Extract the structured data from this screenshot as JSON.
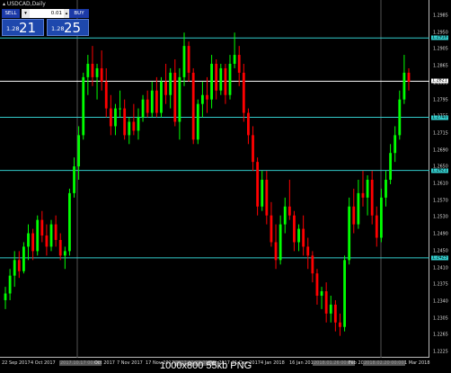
{
  "window": {
    "title": "USDCAD,Daily"
  },
  "trade_panel": {
    "sell_label": "SELL",
    "buy_label": "BUY",
    "lot_minus": "▾",
    "lot_value": "0.01",
    "lot_plus": "▴",
    "sell_price_small": "1.28",
    "sell_price_big": "21",
    "buy_price_small": "1.28",
    "buy_price_big": "25"
  },
  "price_axis": {
    "labels": [
      "1.2985",
      "1.2950",
      "1.2905",
      "1.2865",
      "1.2835",
      "1.2795",
      "1.2755",
      "1.2715",
      "1.2690",
      "1.2650",
      "1.2610",
      "1.2570",
      "1.2530",
      "1.2490",
      "1.2450",
      "1.2410",
      "1.2375",
      "1.2340",
      "1.2305",
      "1.2265",
      "1.2225"
    ],
    "tags": [
      {
        "text": "1.2918",
        "color": "cyan",
        "price": 1.2918
      },
      {
        "text": "1.2821",
        "color": "white",
        "price": 1.2821
      },
      {
        "text": "1.2740",
        "color": "cyan",
        "price": 1.274
      },
      {
        "text": "1.2621",
        "color": "cyan",
        "price": 1.2621
      },
      {
        "text": "1.2425",
        "color": "cyan",
        "price": 1.2425
      }
    ]
  },
  "time_axis": {
    "labels": [
      {
        "text": "22 Sep 2017",
        "sel": false
      },
      {
        "text": "4 Oct 2017",
        "sel": false
      },
      {
        "text": "2017.10.17 00:00",
        "sel": true
      },
      {
        "text": "Oct 2017",
        "sel": false
      },
      {
        "text": "7 Nov 2017",
        "sel": false
      },
      {
        "text": "17 Nov 2017",
        "sel": false
      },
      {
        "text": "2017.11.29 00:00",
        "sel": true
      },
      {
        "text": "Dec 2017",
        "sel": false
      },
      {
        "text": "21 Dec 2017",
        "sel": false
      },
      {
        "text": "4 Jan 2018",
        "sel": false
      },
      {
        "text": "16 Jan 2018",
        "sel": false
      },
      {
        "text": "2018.01.26 00:00",
        "sel": true
      },
      {
        "text": "Feb 2018",
        "sel": false
      },
      {
        "text": "2018.02.20 00:00",
        "sel": true
      },
      {
        "text": "1 Mar 2018",
        "sel": false
      }
    ]
  },
  "watermark": "1000x800 55kb PNG",
  "colors": {
    "bull": "#00ff00",
    "bear": "#ff0000",
    "hline_cyan": "#33cccc",
    "hline_white": "#ffffff"
  },
  "chart_data": {
    "type": "candlestick",
    "symbol": "USDCAD",
    "timeframe": "Daily",
    "ylim": [
      1.2205,
      1.2995
    ],
    "horizontal_levels": [
      1.2918,
      1.2821,
      1.274,
      1.2621,
      1.2425
    ],
    "candles": [
      [
        1.233,
        1.236,
        1.231,
        1.2345
      ],
      [
        1.2345,
        1.24,
        1.233,
        1.2385
      ],
      [
        1.2385,
        1.244,
        1.236,
        1.242
      ],
      [
        1.242,
        1.244,
        1.238,
        1.2395
      ],
      [
        1.2395,
        1.246,
        1.239,
        1.245
      ],
      [
        1.245,
        1.25,
        1.242,
        1.248
      ],
      [
        1.248,
        1.249,
        1.242,
        1.244
      ],
      [
        1.244,
        1.252,
        1.243,
        1.251
      ],
      [
        1.251,
        1.253,
        1.246,
        1.2475
      ],
      [
        1.2475,
        1.25,
        1.243,
        1.245
      ],
      [
        1.245,
        1.251,
        1.244,
        1.25
      ],
      [
        1.25,
        1.252,
        1.245,
        1.2465
      ],
      [
        1.2465,
        1.248,
        1.242,
        1.243
      ],
      [
        1.243,
        1.245,
        1.24,
        1.244
      ],
      [
        1.244,
        1.258,
        1.243,
        1.257
      ],
      [
        1.257,
        1.265,
        1.256,
        1.263
      ],
      [
        1.263,
        1.272,
        1.26,
        1.27
      ],
      [
        1.27,
        1.284,
        1.269,
        1.283
      ],
      [
        1.283,
        1.288,
        1.279,
        1.286
      ],
      [
        1.286,
        1.29,
        1.281,
        1.283
      ],
      [
        1.283,
        1.286,
        1.278,
        1.285
      ],
      [
        1.285,
        1.289,
        1.28,
        1.282
      ],
      [
        1.282,
        1.285,
        1.274,
        1.276
      ],
      [
        1.276,
        1.279,
        1.27,
        1.272
      ],
      [
        1.272,
        1.277,
        1.27,
        1.276
      ],
      [
        1.276,
        1.28,
        1.274,
        1.276
      ],
      [
        1.276,
        1.278,
        1.269,
        1.27
      ],
      [
        1.27,
        1.274,
        1.268,
        1.273
      ],
      [
        1.273,
        1.277,
        1.27,
        1.271
      ],
      [
        1.271,
        1.276,
        1.269,
        1.274
      ],
      [
        1.274,
        1.279,
        1.273,
        1.278
      ],
      [
        1.278,
        1.28,
        1.274,
        1.275
      ],
      [
        1.275,
        1.282,
        1.274,
        1.28
      ],
      [
        1.28,
        1.283,
        1.274,
        1.275
      ],
      [
        1.275,
        1.283,
        1.274,
        1.282
      ],
      [
        1.282,
        1.286,
        1.277,
        1.279
      ],
      [
        1.279,
        1.285,
        1.276,
        1.284
      ],
      [
        1.284,
        1.287,
        1.272,
        1.273
      ],
      [
        1.273,
        1.285,
        1.269,
        1.283
      ],
      [
        1.283,
        1.293,
        1.281,
        1.29
      ],
      [
        1.29,
        1.291,
        1.282,
        1.284
      ],
      [
        1.284,
        1.285,
        1.268,
        1.269
      ],
      [
        1.269,
        1.278,
        1.268,
        1.277
      ],
      [
        1.277,
        1.282,
        1.274,
        1.279
      ],
      [
        1.279,
        1.283,
        1.275,
        1.278
      ],
      [
        1.278,
        1.288,
        1.276,
        1.286
      ],
      [
        1.286,
        1.287,
        1.278,
        1.28
      ],
      [
        1.28,
        1.286,
        1.279,
        1.285
      ],
      [
        1.285,
        1.286,
        1.277,
        1.279
      ],
      [
        1.279,
        1.288,
        1.278,
        1.286
      ],
      [
        1.286,
        1.293,
        1.285,
        1.288
      ],
      [
        1.288,
        1.29,
        1.281,
        1.284
      ],
      [
        1.284,
        1.286,
        1.273,
        1.275
      ],
      [
        1.275,
        1.276,
        1.268,
        1.27
      ],
      [
        1.27,
        1.272,
        1.262,
        1.264
      ],
      [
        1.264,
        1.265,
        1.252,
        1.254
      ],
      [
        1.254,
        1.262,
        1.253,
        1.26
      ],
      [
        1.26,
        1.262,
        1.25,
        1.252
      ],
      [
        1.252,
        1.255,
        1.245,
        1.246
      ],
      [
        1.246,
        1.25,
        1.24,
        1.242
      ],
      [
        1.242,
        1.252,
        1.241,
        1.25
      ],
      [
        1.25,
        1.256,
        1.248,
        1.254
      ],
      [
        1.254,
        1.26,
        1.251,
        1.252
      ],
      [
        1.252,
        1.253,
        1.244,
        1.246
      ],
      [
        1.246,
        1.25,
        1.244,
        1.249
      ],
      [
        1.249,
        1.252,
        1.243,
        1.245
      ],
      [
        1.245,
        1.247,
        1.24,
        1.243
      ],
      [
        1.243,
        1.244,
        1.237,
        1.239
      ],
      [
        1.239,
        1.24,
        1.232,
        1.234
      ],
      [
        1.234,
        1.236,
        1.231,
        1.235
      ],
      [
        1.235,
        1.237,
        1.228,
        1.23
      ],
      [
        1.23,
        1.234,
        1.228,
        1.232
      ],
      [
        1.232,
        1.233,
        1.226,
        1.228
      ],
      [
        1.228,
        1.23,
        1.225,
        1.227
      ],
      [
        1.227,
        1.243,
        1.226,
        1.242
      ],
      [
        1.242,
        1.256,
        1.241,
        1.254
      ],
      [
        1.254,
        1.258,
        1.248,
        1.25
      ],
      [
        1.25,
        1.26,
        1.249,
        1.257
      ],
      [
        1.257,
        1.262,
        1.254,
        1.256
      ],
      [
        1.256,
        1.261,
        1.252,
        1.26
      ],
      [
        1.26,
        1.262,
        1.25,
        1.252
      ],
      [
        1.252,
        1.254,
        1.245,
        1.247
      ],
      [
        1.247,
        1.258,
        1.246,
        1.256
      ],
      [
        1.256,
        1.262,
        1.254,
        1.26
      ],
      [
        1.26,
        1.268,
        1.259,
        1.266
      ],
      [
        1.266,
        1.272,
        1.264,
        1.27
      ],
      [
        1.27,
        1.28,
        1.269,
        1.278
      ],
      [
        1.278,
        1.288,
        1.277,
        1.284
      ],
      [
        1.284,
        1.285,
        1.28,
        1.282
      ]
    ]
  }
}
